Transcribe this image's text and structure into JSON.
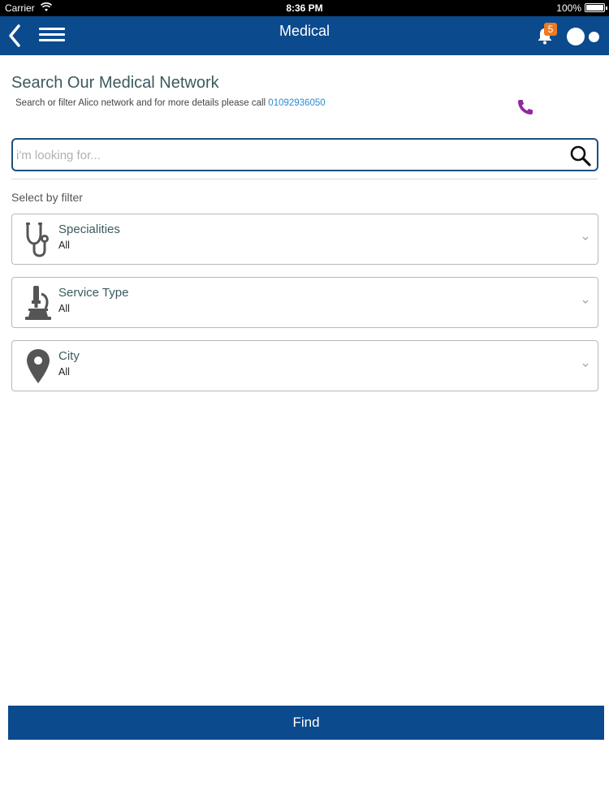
{
  "status_bar": {
    "carrier": "Carrier",
    "time": "8:36 PM",
    "battery": "100%"
  },
  "nav": {
    "title": "Medical",
    "notification_count": "5",
    "icons": [
      "back-chevron-icon",
      "hamburger-menu-icon",
      "bell-icon",
      "toggle-dots-icon"
    ]
  },
  "main": {
    "heading": "Search Our Medical Network",
    "subtitle_text": "Search or filter Alico network and for more details please call",
    "phone_number": "01092936050",
    "search": {
      "placeholder": "i'm looking for...",
      "value": ""
    },
    "filter_label": "Select by filter",
    "filters": [
      {
        "title": "Specialities",
        "value": "All",
        "icon": "stethoscope-icon"
      },
      {
        "title": "Service Type",
        "value": "All",
        "icon": "microscope-icon"
      },
      {
        "title": "City",
        "value": "All",
        "icon": "map-pin-icon"
      }
    ],
    "find_label": "Find"
  },
  "colors": {
    "nav_bg": "#0b4a8d",
    "heading": "#3b5a5f",
    "link": "#2a8bd0",
    "phone_icon": "#8e2a9c",
    "badge": "#f07a22"
  }
}
